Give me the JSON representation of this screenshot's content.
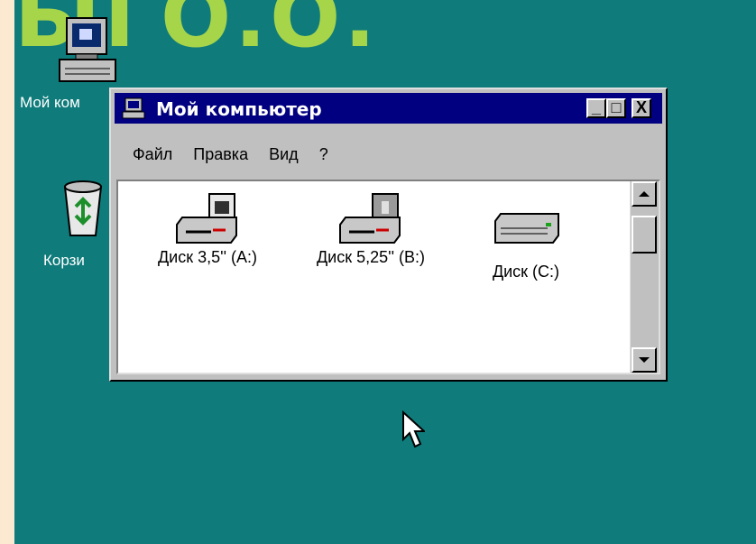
{
  "slide": {
    "banner_text": "ЫГО.О."
  },
  "desktop": {
    "icons": [
      {
        "label": "Мой ком",
        "icon": "my-computer-icon"
      },
      {
        "label": "Корзи",
        "icon": "recycle-bin-icon"
      }
    ],
    "background_color": "#0f7b7b"
  },
  "window": {
    "title": "Мой компьютер",
    "title_icon": "computer-icon",
    "buttons": {
      "minimize": "_",
      "maximize": "□",
      "close": "X"
    },
    "menu": [
      {
        "label": "Файл"
      },
      {
        "label": "Правка"
      },
      {
        "label": "Вид"
      },
      {
        "label": "?"
      }
    ],
    "items": [
      {
        "label": "Диск 3,5'' (A:)",
        "icon": "floppy-drive-icon"
      },
      {
        "label": "Диск 5,25'' (B:)",
        "icon": "floppy-drive-icon"
      },
      {
        "label": "Диск (C:)",
        "icon": "hard-drive-icon"
      }
    ],
    "titlebar_color": "#000080"
  }
}
